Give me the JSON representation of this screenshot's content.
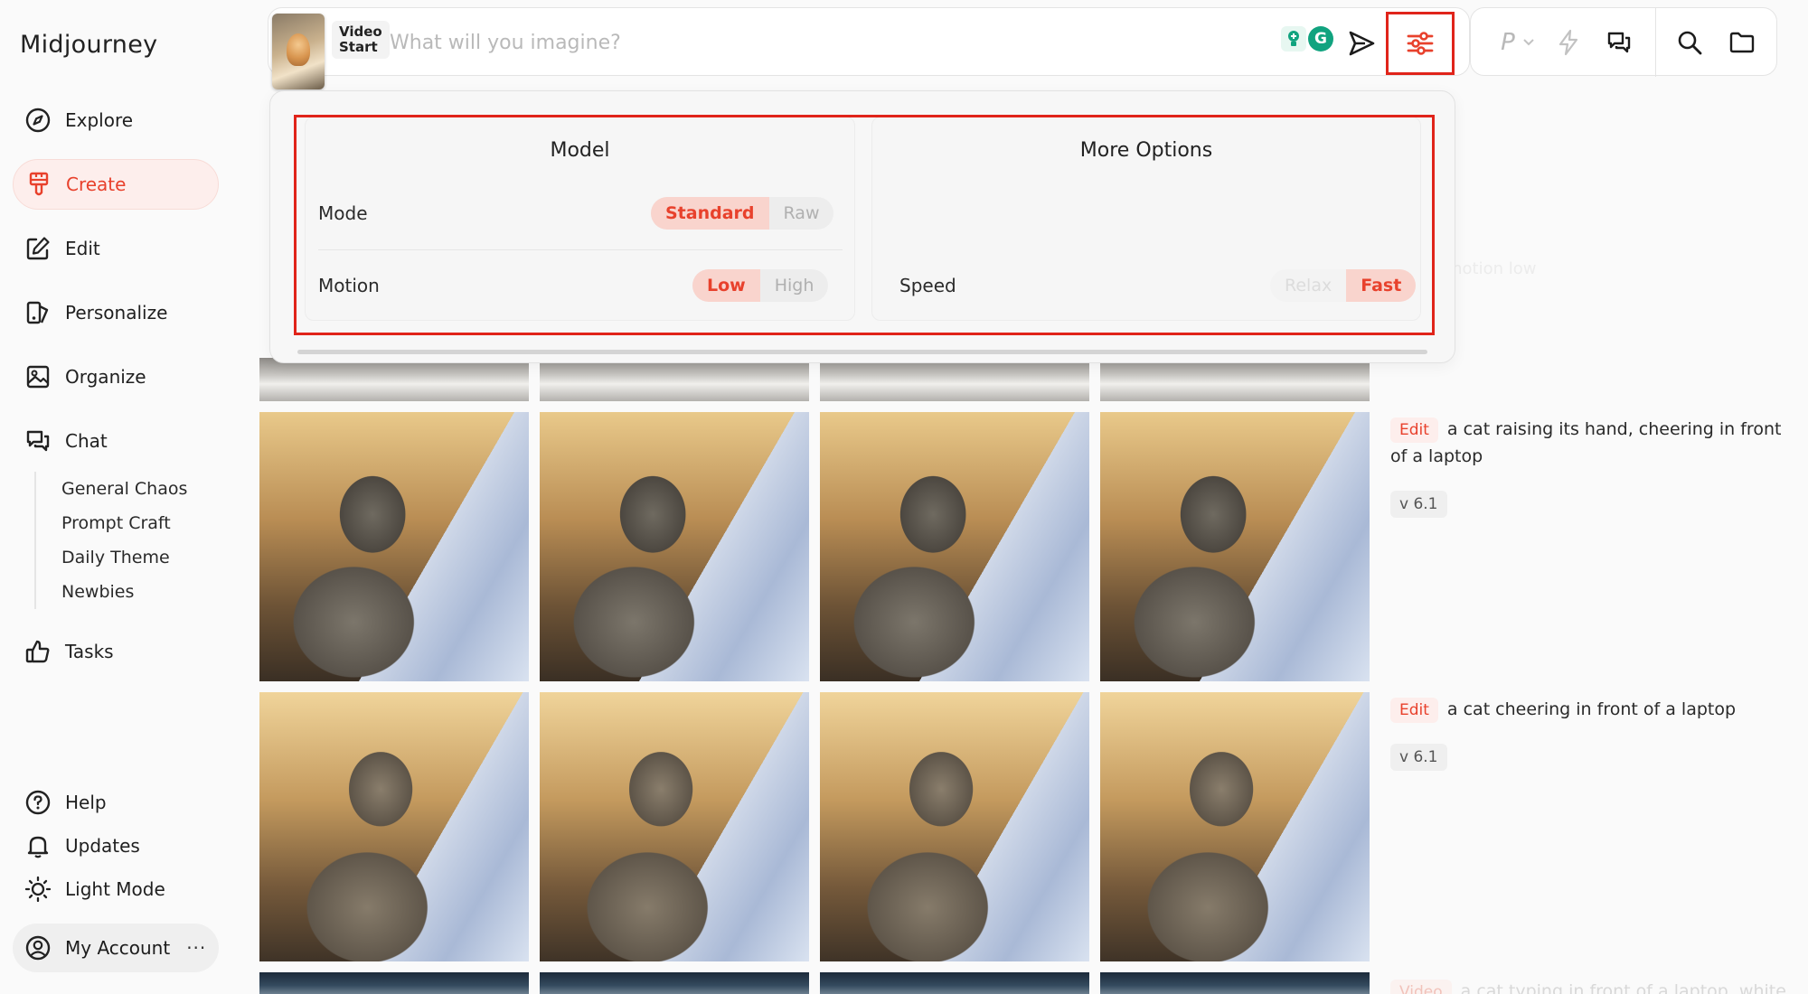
{
  "app": {
    "brand": "Midjourney"
  },
  "sidebar": {
    "items": [
      {
        "label": "Explore",
        "icon": "compass-icon"
      },
      {
        "label": "Create",
        "icon": "brush-icon",
        "active": true
      },
      {
        "label": "Edit",
        "icon": "edit-icon"
      },
      {
        "label": "Personalize",
        "icon": "personalize-icon"
      },
      {
        "label": "Organize",
        "icon": "image-icon"
      },
      {
        "label": "Chat",
        "icon": "chat-icon"
      }
    ],
    "chat_channels": [
      "General Chaos",
      "Prompt Craft",
      "Daily Theme",
      "Newbies"
    ],
    "tasks_label": "Tasks",
    "bottom": [
      {
        "label": "Help",
        "icon": "help-icon"
      },
      {
        "label": "Updates",
        "icon": "bell-icon"
      },
      {
        "label": "Light Mode",
        "icon": "sun-icon"
      }
    ],
    "account_label": "My Account",
    "account_more": "···"
  },
  "prompt": {
    "video_label_line1": "Video",
    "video_label_line2": "Start",
    "placeholder": "What will you imagine?",
    "grammarly_glyph": "G"
  },
  "toolbar": {
    "personalize_glyph": "P"
  },
  "settings": {
    "model_title": "Model",
    "more_title": "More Options",
    "mode_label": "Mode",
    "mode_options": [
      "Standard",
      "Raw"
    ],
    "mode_selected": "Standard",
    "motion_label": "Motion",
    "motion_options": [
      "Low",
      "High"
    ],
    "motion_selected": "Low",
    "speed_label": "Speed",
    "speed_options": [
      "Relax",
      "Fast"
    ],
    "speed_selected": "Fast"
  },
  "jobs": [
    {
      "edit": "Edit",
      "prompt": "a cat raising its hand, cheering in front of a laptop",
      "version": "v 6.1"
    },
    {
      "edit": "Edit",
      "prompt": "a cat cheering in front of a laptop",
      "version": "v 6.1"
    }
  ],
  "faded": {
    "motion_text": "motion low",
    "bottom_tag": "Video",
    "bottom_prompt": "a cat typing in front of a laptop, white"
  },
  "colors": {
    "accent": "#e8412c",
    "highlight": "#e0241a"
  }
}
